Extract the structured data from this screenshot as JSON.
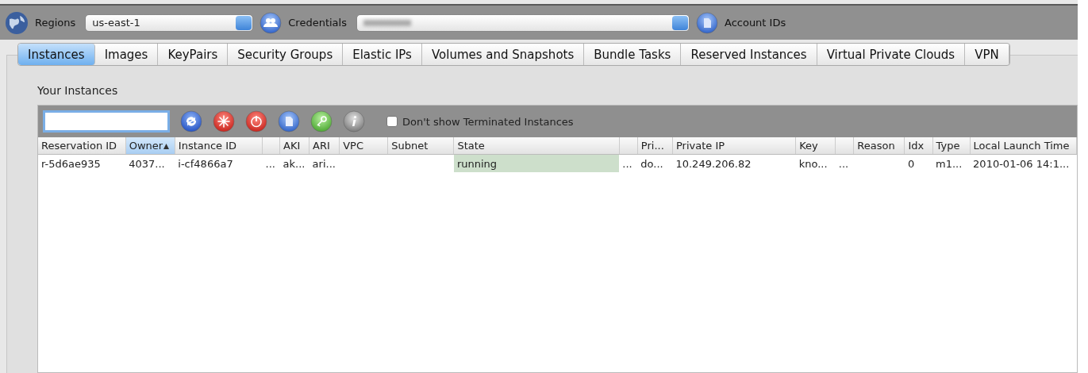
{
  "toolbar": {
    "regions": {
      "label": "Regions",
      "value": "us-east-1"
    },
    "credentials": {
      "label": "Credentials"
    },
    "account": {
      "label": "Account IDs"
    }
  },
  "tabs": [
    {
      "label": "Instances",
      "selected": true
    },
    {
      "label": "Images",
      "selected": false
    },
    {
      "label": "KeyPairs",
      "selected": false
    },
    {
      "label": "Security Groups",
      "selected": false
    },
    {
      "label": "Elastic IPs",
      "selected": false
    },
    {
      "label": "Volumes and Snapshots",
      "selected": false
    },
    {
      "label": "Bundle Tasks",
      "selected": false
    },
    {
      "label": "Reserved Instances",
      "selected": false
    },
    {
      "label": "Virtual Private Clouds",
      "selected": false
    },
    {
      "label": "VPN",
      "selected": false
    }
  ],
  "section_title": "Your Instances",
  "instance_toolbar": {
    "buttons": [
      {
        "kind": "refresh"
      },
      {
        "kind": "launch"
      },
      {
        "kind": "stop"
      },
      {
        "kind": "document"
      },
      {
        "kind": "key"
      },
      {
        "kind": "info"
      }
    ],
    "hide_terminated": {
      "label": "Don't show Terminated Instances",
      "checked": false
    }
  },
  "table": {
    "columns": [
      {
        "label": "Reservation ID",
        "sorted": false
      },
      {
        "label": "Owner",
        "sorted": true
      },
      {
        "label": "Instance ID",
        "sorted": false
      },
      {
        "sorted": false
      },
      {
        "label": "AKI",
        "sorted": false
      },
      {
        "label": "ARI",
        "sorted": false
      },
      {
        "label": "VPC",
        "sorted": false
      },
      {
        "label": "Subnet",
        "sorted": false
      },
      {
        "label": "State",
        "sorted": false
      },
      {
        "sorted": false
      },
      {
        "label": "Pri...",
        "sorted": false
      },
      {
        "label": "Private IP",
        "sorted": false
      },
      {
        "label": "Key",
        "sorted": false
      },
      {
        "sorted": false
      },
      {
        "label": "Reason",
        "sorted": false
      },
      {
        "label": "Idx",
        "sorted": false
      },
      {
        "label": "Type",
        "sorted": false
      },
      {
        "label": "Local Launch Time",
        "sorted": false
      }
    ],
    "rows": [
      {
        "cells": [
          {
            "text": "r-5d6ae935",
            "highlighted": false
          },
          {
            "text": "4037...",
            "highlighted": false
          },
          {
            "text": "i-cf4866a7",
            "highlighted": false
          },
          {
            "text": "...",
            "highlighted": false
          },
          {
            "text": "ak...",
            "highlighted": false
          },
          {
            "text": "ari...",
            "highlighted": false
          },
          {
            "highlighted": false
          },
          {
            "highlighted": false
          },
          {
            "text": "running",
            "highlighted": true
          },
          {
            "text": "...",
            "highlighted": false
          },
          {
            "text": "do...",
            "highlighted": false
          },
          {
            "text": "10.249.206.82",
            "highlighted": false
          },
          {
            "text": "kno...",
            "highlighted": false
          },
          {
            "text": "...",
            "highlighted": false
          },
          {
            "highlighted": false
          },
          {
            "text": "0",
            "highlighted": false
          },
          {
            "text": "m1...",
            "highlighted": false
          },
          {
            "text": "2010-01-06 14:1...",
            "highlighted": false
          }
        ]
      }
    ]
  }
}
